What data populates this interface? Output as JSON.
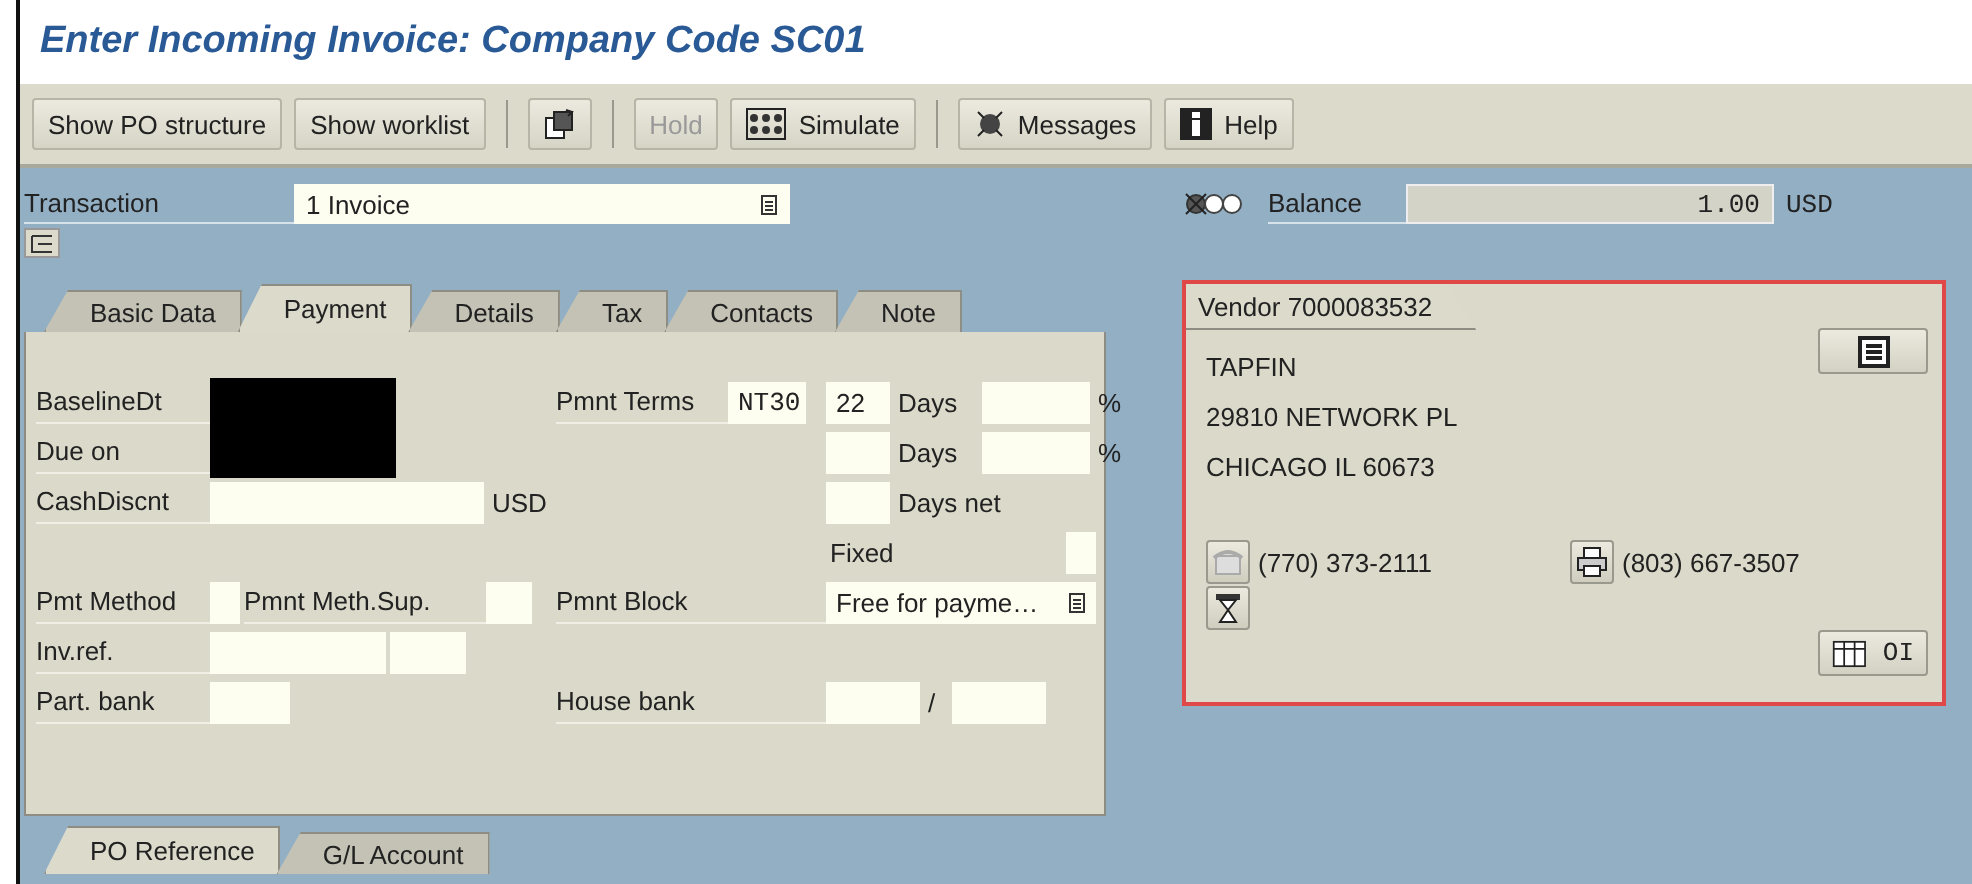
{
  "window": {
    "title": "Enter Incoming Invoice: Company Code SC01"
  },
  "toolbar": [
    {
      "kind": "text",
      "label": "Show PO structure",
      "disabled": false
    },
    {
      "kind": "text",
      "label": "Show worklist",
      "disabled": false
    },
    {
      "kind": "separator"
    },
    {
      "kind": "icon",
      "disabled": false
    },
    {
      "kind": "separator"
    },
    {
      "kind": "text",
      "label": "Hold",
      "disabled": true
    },
    {
      "kind": "simulate",
      "label": "Simulate",
      "disabled": false
    },
    {
      "kind": "separator"
    },
    {
      "kind": "messages",
      "label": "Messages",
      "disabled": false
    },
    {
      "kind": "help",
      "label": "Help",
      "disabled": false
    }
  ],
  "transaction": {
    "label": "Transaction",
    "value": "1 Invoice"
  },
  "balance": {
    "label": "Balance",
    "value": "1.00",
    "currency": "USD"
  },
  "tabs": [
    {
      "label": "Basic Data",
      "selected": false
    },
    {
      "label": "Payment",
      "selected": true
    },
    {
      "label": "Details",
      "selected": false
    },
    {
      "label": "Tax",
      "selected": false
    },
    {
      "label": "Contacts",
      "selected": false
    },
    {
      "label": "Note",
      "selected": false
    }
  ],
  "payment": {
    "baseline_date": {
      "label": "BaselineDt",
      "redacted": true
    },
    "due_on": {
      "label": "Due on",
      "redacted": true
    },
    "cash_discount": {
      "label": "CashDiscnt",
      "currency": "USD"
    },
    "payment_terms": {
      "label": "Pmnt Terms",
      "value": "NT30"
    },
    "terms_lines": [
      {
        "days": "22",
        "label": "Days",
        "suffix": "%"
      },
      {
        "label": "Days",
        "suffix": "%"
      },
      {
        "label": "Days net"
      }
    ],
    "fixed": {
      "label": "Fixed"
    },
    "pmt_method": {
      "label": "Pmt Method"
    },
    "pmt_meth_sup": {
      "label": "Pmnt Meth.Sup."
    },
    "payment_block": {
      "label": "Pmnt Block",
      "value": "Free for payme…"
    },
    "inv_ref": {
      "label": "Inv.ref."
    },
    "part_bank": {
      "label": "Part. bank"
    },
    "house_bank": {
      "label": "House bank",
      "separator": "/"
    }
  },
  "bottom_tabs": [
    {
      "label": "PO Reference",
      "selected": true
    },
    {
      "label": "G/L Account",
      "selected": false
    }
  ],
  "vendor": {
    "title": "Vendor 7000083532",
    "highlighted": true,
    "address": [
      "TAPFIN",
      "29810 NETWORK PL",
      "CHICAGO IL  60673"
    ],
    "phone": "(770) 373-2111",
    "fax": "(803) 667-3507",
    "oi_button": "OI"
  }
}
